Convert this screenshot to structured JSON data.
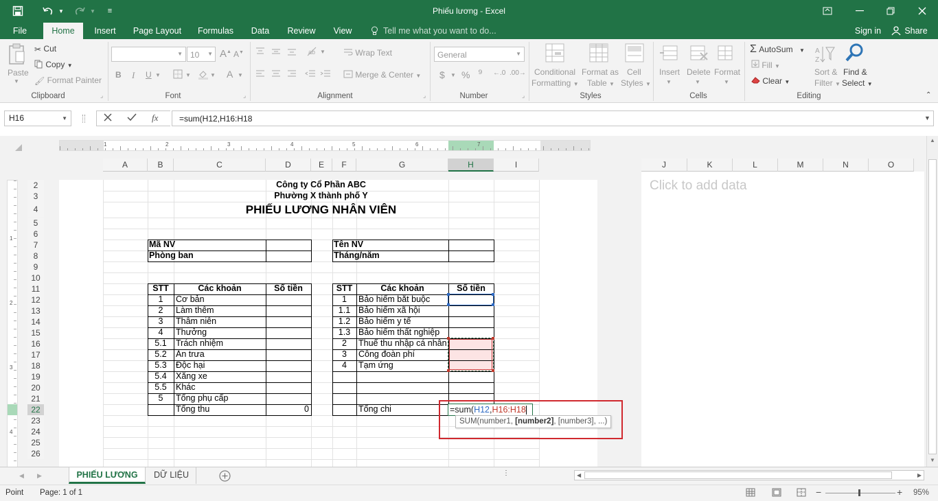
{
  "window": {
    "title": "Phiếu lương - Excel"
  },
  "tabs": [
    {
      "label": "File"
    },
    {
      "label": "Home"
    },
    {
      "label": "Insert"
    },
    {
      "label": "Page Layout"
    },
    {
      "label": "Formulas"
    },
    {
      "label": "Data"
    },
    {
      "label": "Review"
    },
    {
      "label": "View"
    }
  ],
  "tell_me": "Tell me what you want to do...",
  "signin": "Sign in",
  "share": "Share",
  "ribbon": {
    "paste": "Paste",
    "cut": "Cut",
    "copy": "Copy",
    "format_painter": "Format Painter",
    "clipboard": "Clipboard",
    "font_size": "10",
    "font": "Font",
    "bold": "B",
    "italic": "I",
    "underline": "U",
    "wrap_text": "Wrap Text",
    "merge_center": "Merge & Center",
    "alignment": "Alignment",
    "number_format": "General",
    "number": "Number",
    "conditional_formatting_1": "Conditional",
    "conditional_formatting_2": "Formatting",
    "format_as_table_1": "Format as",
    "format_as_table_2": "Table",
    "cell_styles_1": "Cell",
    "cell_styles_2": "Styles",
    "styles": "Styles",
    "insert": "Insert",
    "delete": "Delete",
    "format": "Format",
    "cells": "Cells",
    "autosum": "AutoSum",
    "fill": "Fill",
    "clear": "Clear",
    "sort_filter_1": "Sort &",
    "sort_filter_2": "Filter",
    "find_select_1": "Find &",
    "find_select_2": "Select",
    "editing": "Editing"
  },
  "formula_bar": {
    "name_box": "H16",
    "fx": "fx",
    "formula": "=sum(H12,H16:H18"
  },
  "columns_left": [
    "A",
    "B",
    "C",
    "D",
    "E",
    "F",
    "G",
    "H",
    "I"
  ],
  "columns_right": [
    "J",
    "K",
    "L",
    "M",
    "N",
    "O"
  ],
  "rows": [
    "2",
    "3",
    "4",
    "5",
    "6",
    "7",
    "8",
    "9",
    "10",
    "11",
    "12",
    "13",
    "14",
    "15",
    "16",
    "17",
    "18",
    "19",
    "20",
    "21",
    "22",
    "23",
    "24",
    "25",
    "26"
  ],
  "ruler_numbers": [
    "1",
    "2",
    "3",
    "4",
    "5",
    "6",
    "7"
  ],
  "vruler_numbers": [
    "1",
    "2",
    "3",
    "4"
  ],
  "right_pane": {
    "placeholder": "Click to add data"
  },
  "sheet": {
    "company": "Công ty Cổ Phần ABC",
    "address": "Phường X thành phố Y",
    "title": "PHIẾU LƯƠNG NHÂN VIÊN",
    "ma_nv": "Mã NV",
    "phong_ban": "Phòng ban",
    "ten_nv": "Tên NV",
    "thang_nam": "Tháng/năm",
    "hdr_stt": "STT",
    "hdr_cac_khoan": "Các khoản",
    "hdr_so_tien": "Số tiền",
    "left_items": [
      {
        "stt": "1",
        "name": "Cơ bản"
      },
      {
        "stt": "2",
        "name": "Làm thêm"
      },
      {
        "stt": "3",
        "name": "Thâm niên"
      },
      {
        "stt": "4",
        "name": "Thưởng"
      },
      {
        "stt": "5.1",
        "name": "Trách nhiệm"
      },
      {
        "stt": "5.2",
        "name": "Ăn trưa"
      },
      {
        "stt": "5.3",
        "name": "Độc hại"
      },
      {
        "stt": "5.4",
        "name": "Xăng xe"
      },
      {
        "stt": "5.5",
        "name": "Khác"
      },
      {
        "stt": "5",
        "name": "Tổng phụ cấp"
      }
    ],
    "right_items": [
      {
        "stt": "1",
        "name": "Bảo hiểm bắt buộc"
      },
      {
        "stt": "1.1",
        "name": "Bảo hiểm xã hội"
      },
      {
        "stt": "1.2",
        "name": "Bảo hiểm y tế"
      },
      {
        "stt": "1.3",
        "name": "Bảo hiểm thất nghiệp"
      },
      {
        "stt": "2",
        "name": "Thuế thu nhập cá nhân"
      },
      {
        "stt": "3",
        "name": "Công đoàn phí"
      },
      {
        "stt": "4",
        "name": "Tạm ứng"
      }
    ],
    "tong_thu": "Tổng thu",
    "tong_thu_value": "0",
    "tong_chi": "Tổng chi",
    "edit_prefix": "=sum(",
    "edit_ref1": "H12",
    ",": ",",
    "edit_ref2": "H16:H18",
    "tooltip_a": "SUM(number1, ",
    "tooltip_b": "[number2]",
    "tooltip_c": ", [number3], ...)"
  },
  "sheet_tabs": [
    {
      "label": "PHIẾU LƯƠNG"
    },
    {
      "label": "DỮ LIỆU"
    }
  ],
  "status": {
    "mode": "Point",
    "page": "Page: 1 of 1",
    "zoom": "95%"
  },
  "colors": {
    "brand": "#217346",
    "ref_blue": "#2f6bc4",
    "ref_red": "#c0392b",
    "highlight": "#d0282e"
  }
}
